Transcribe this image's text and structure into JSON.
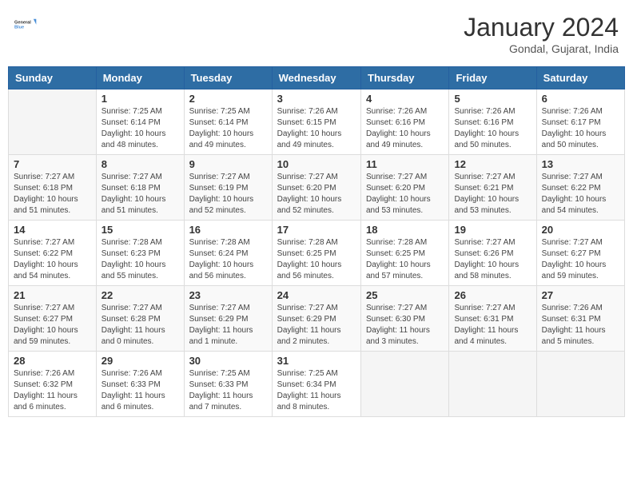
{
  "header": {
    "logo_general": "General",
    "logo_blue": "Blue",
    "month_year": "January 2024",
    "location": "Gondal, Gujarat, India"
  },
  "days_of_week": [
    "Sunday",
    "Monday",
    "Tuesday",
    "Wednesday",
    "Thursday",
    "Friday",
    "Saturday"
  ],
  "weeks": [
    [
      {
        "day": "",
        "info": ""
      },
      {
        "day": "1",
        "info": "Sunrise: 7:25 AM\nSunset: 6:14 PM\nDaylight: 10 hours\nand 48 minutes."
      },
      {
        "day": "2",
        "info": "Sunrise: 7:25 AM\nSunset: 6:14 PM\nDaylight: 10 hours\nand 49 minutes."
      },
      {
        "day": "3",
        "info": "Sunrise: 7:26 AM\nSunset: 6:15 PM\nDaylight: 10 hours\nand 49 minutes."
      },
      {
        "day": "4",
        "info": "Sunrise: 7:26 AM\nSunset: 6:16 PM\nDaylight: 10 hours\nand 49 minutes."
      },
      {
        "day": "5",
        "info": "Sunrise: 7:26 AM\nSunset: 6:16 PM\nDaylight: 10 hours\nand 50 minutes."
      },
      {
        "day": "6",
        "info": "Sunrise: 7:26 AM\nSunset: 6:17 PM\nDaylight: 10 hours\nand 50 minutes."
      }
    ],
    [
      {
        "day": "7",
        "info": "Sunrise: 7:27 AM\nSunset: 6:18 PM\nDaylight: 10 hours\nand 51 minutes."
      },
      {
        "day": "8",
        "info": "Sunrise: 7:27 AM\nSunset: 6:18 PM\nDaylight: 10 hours\nand 51 minutes."
      },
      {
        "day": "9",
        "info": "Sunrise: 7:27 AM\nSunset: 6:19 PM\nDaylight: 10 hours\nand 52 minutes."
      },
      {
        "day": "10",
        "info": "Sunrise: 7:27 AM\nSunset: 6:20 PM\nDaylight: 10 hours\nand 52 minutes."
      },
      {
        "day": "11",
        "info": "Sunrise: 7:27 AM\nSunset: 6:20 PM\nDaylight: 10 hours\nand 53 minutes."
      },
      {
        "day": "12",
        "info": "Sunrise: 7:27 AM\nSunset: 6:21 PM\nDaylight: 10 hours\nand 53 minutes."
      },
      {
        "day": "13",
        "info": "Sunrise: 7:27 AM\nSunset: 6:22 PM\nDaylight: 10 hours\nand 54 minutes."
      }
    ],
    [
      {
        "day": "14",
        "info": "Sunrise: 7:27 AM\nSunset: 6:22 PM\nDaylight: 10 hours\nand 54 minutes."
      },
      {
        "day": "15",
        "info": "Sunrise: 7:28 AM\nSunset: 6:23 PM\nDaylight: 10 hours\nand 55 minutes."
      },
      {
        "day": "16",
        "info": "Sunrise: 7:28 AM\nSunset: 6:24 PM\nDaylight: 10 hours\nand 56 minutes."
      },
      {
        "day": "17",
        "info": "Sunrise: 7:28 AM\nSunset: 6:25 PM\nDaylight: 10 hours\nand 56 minutes."
      },
      {
        "day": "18",
        "info": "Sunrise: 7:28 AM\nSunset: 6:25 PM\nDaylight: 10 hours\nand 57 minutes."
      },
      {
        "day": "19",
        "info": "Sunrise: 7:27 AM\nSunset: 6:26 PM\nDaylight: 10 hours\nand 58 minutes."
      },
      {
        "day": "20",
        "info": "Sunrise: 7:27 AM\nSunset: 6:27 PM\nDaylight: 10 hours\nand 59 minutes."
      }
    ],
    [
      {
        "day": "21",
        "info": "Sunrise: 7:27 AM\nSunset: 6:27 PM\nDaylight: 10 hours\nand 59 minutes."
      },
      {
        "day": "22",
        "info": "Sunrise: 7:27 AM\nSunset: 6:28 PM\nDaylight: 11 hours\nand 0 minutes."
      },
      {
        "day": "23",
        "info": "Sunrise: 7:27 AM\nSunset: 6:29 PM\nDaylight: 11 hours\nand 1 minute."
      },
      {
        "day": "24",
        "info": "Sunrise: 7:27 AM\nSunset: 6:29 PM\nDaylight: 11 hours\nand 2 minutes."
      },
      {
        "day": "25",
        "info": "Sunrise: 7:27 AM\nSunset: 6:30 PM\nDaylight: 11 hours\nand 3 minutes."
      },
      {
        "day": "26",
        "info": "Sunrise: 7:27 AM\nSunset: 6:31 PM\nDaylight: 11 hours\nand 4 minutes."
      },
      {
        "day": "27",
        "info": "Sunrise: 7:26 AM\nSunset: 6:31 PM\nDaylight: 11 hours\nand 5 minutes."
      }
    ],
    [
      {
        "day": "28",
        "info": "Sunrise: 7:26 AM\nSunset: 6:32 PM\nDaylight: 11 hours\nand 6 minutes."
      },
      {
        "day": "29",
        "info": "Sunrise: 7:26 AM\nSunset: 6:33 PM\nDaylight: 11 hours\nand 6 minutes."
      },
      {
        "day": "30",
        "info": "Sunrise: 7:25 AM\nSunset: 6:33 PM\nDaylight: 11 hours\nand 7 minutes."
      },
      {
        "day": "31",
        "info": "Sunrise: 7:25 AM\nSunset: 6:34 PM\nDaylight: 11 hours\nand 8 minutes."
      },
      {
        "day": "",
        "info": ""
      },
      {
        "day": "",
        "info": ""
      },
      {
        "day": "",
        "info": ""
      }
    ]
  ]
}
